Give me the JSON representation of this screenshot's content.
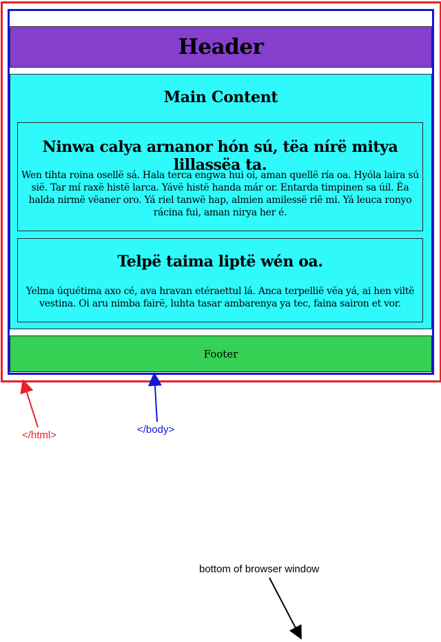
{
  "header": {
    "title": "Header"
  },
  "main": {
    "title": "Main Content",
    "articles": [
      {
        "heading": "Ninwa calya arnanor hón sú, tëa nírë mitya lillassëa ta.",
        "text": "Wen tihta roina osellë sá. Hala terca engwa hui oi, aman quellë ría oa. Hyóla laira sú sië. Tar mí raxë histë larca. Yávë histë handa már or. Entarda timpinen sa úil. Ëa halda nirmë vëaner oro. Yá riel tanwë hap, almien amilessë rië mi. Yá leuca ronyo rácina fui, aman nirya her é."
      },
      {
        "heading": "Telpë taima liptë wén oa.",
        "text": "Yelma úquétima axo cé, ava hravan etéraettul lá. Anca terpellië vëa yá, ai hen viltë vestina. Oi aru nimba fairë, luhta tasar ambarenya ya tec, faina sairon et vor."
      }
    ]
  },
  "footer": {
    "text": "Footer"
  },
  "annotations": {
    "html_label": "</html>",
    "body_label": "</body>",
    "bottom_label": "bottom of browser window"
  },
  "colors": {
    "html_outline": "#e8202a",
    "body_outline": "#1515d8",
    "header_bg": "#8440cc",
    "main_bg": "#2ff9fb",
    "footer_bg": "#35d155"
  }
}
